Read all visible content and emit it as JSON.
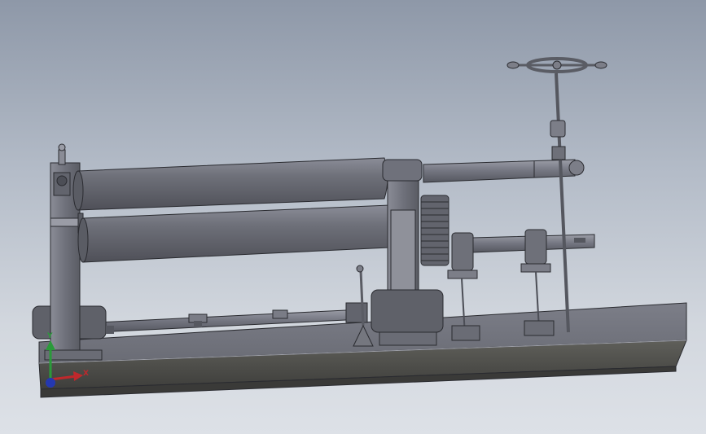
{
  "viewport": {
    "background_top": "#8e98a8",
    "background_bottom": "#dde1e7"
  },
  "model": {
    "type": "3-roll plate rolling machine assembly",
    "parts": [
      "base-frame",
      "left-housing",
      "right-housing",
      "upper-roll",
      "lower-roll",
      "drive-gear",
      "handwheel",
      "lead-screw",
      "drive-shaft",
      "motor-left",
      "motor-right",
      "lever",
      "support-bracket"
    ],
    "colors": {
      "steel_dark": "#55575f",
      "steel_mid": "#747680",
      "steel_light": "#9a9ca6",
      "roll": "#6b6d78",
      "outline": "#2a2b30"
    }
  },
  "triad": {
    "x_label": "X",
    "y_label": "Y",
    "x_color": "#c0282c",
    "y_color": "#2a9a3a",
    "z_color": "#2438b0",
    "icons": [
      "x-axis-arrow-icon",
      "y-axis-arrow-icon",
      "z-axis-dot-icon"
    ]
  }
}
